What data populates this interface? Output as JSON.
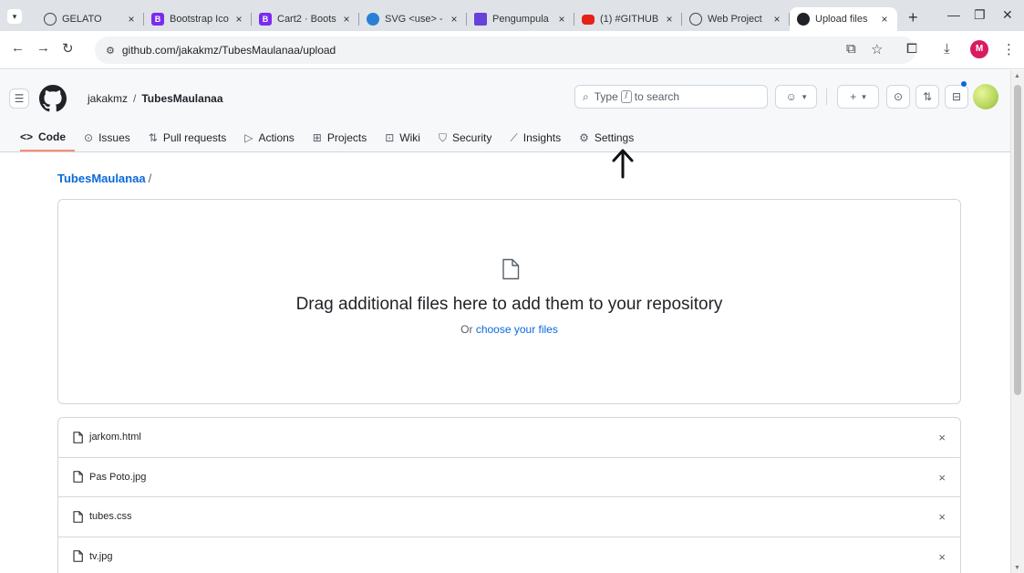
{
  "browser": {
    "tabs": [
      {
        "title": "GELATO",
        "icon": "globe-icon"
      },
      {
        "title": "Bootstrap Ico",
        "icon": "bootstrap-icon"
      },
      {
        "title": "Cart2 · Boots",
        "icon": "bootstrap-icon"
      },
      {
        "title": "SVG <use> -",
        "icon": "svg-site-icon"
      },
      {
        "title": "Pengumpula",
        "icon": "forms-icon"
      },
      {
        "title": "(1) #GITHUB",
        "icon": "youtube-icon"
      },
      {
        "title": "Web Project",
        "icon": "globe-icon"
      },
      {
        "title": "Upload files",
        "icon": "github-icon",
        "active": true
      }
    ],
    "bootstrap_glyph": "B",
    "close_glyph": "×",
    "new_tab_glyph": "+",
    "address": "github.com/jakakmz/TubesMaulanaa/upload",
    "profile_initial": "M",
    "profile_color": "#d81b60"
  },
  "github": {
    "owner": "jakakmz",
    "separator": "/",
    "repo": "TubesMaulanaa",
    "search_prefix": "Type",
    "search_key": "/",
    "search_suffix": "to search",
    "nav": [
      {
        "label": "Code",
        "icon": "code-icon",
        "active": true
      },
      {
        "label": "Issues",
        "icon": "issue-icon"
      },
      {
        "label": "Pull requests",
        "icon": "pull-request-icon"
      },
      {
        "label": "Actions",
        "icon": "actions-play-icon"
      },
      {
        "label": "Projects",
        "icon": "table-icon"
      },
      {
        "label": "Wiki",
        "icon": "book-icon"
      },
      {
        "label": "Security",
        "icon": "shield-icon"
      },
      {
        "label": "Insights",
        "icon": "graph-icon"
      },
      {
        "label": "Settings",
        "icon": "gear-icon"
      }
    ]
  },
  "upload": {
    "path_repo": "TubesMaulanaa",
    "path_slash": "/",
    "drop_title": "Drag additional files here to add them to your repository",
    "drop_sub_prefix": "Or",
    "drop_sub_link": "choose your files",
    "files": [
      {
        "name": "jarkom.html"
      },
      {
        "name": "Pas Poto.jpg"
      },
      {
        "name": "tubes.css"
      },
      {
        "name": "tv.jpg"
      }
    ]
  },
  "colors": {
    "link": "#0969da",
    "active_tab_underline": "#fd8c73"
  }
}
